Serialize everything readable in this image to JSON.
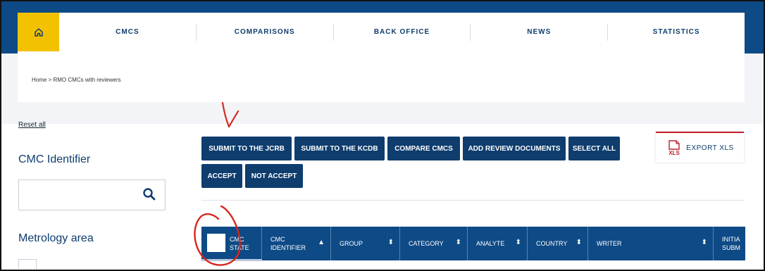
{
  "nav": {
    "items": [
      "CMCS",
      "COMPARISONS",
      "BACK OFFICE",
      "NEWS",
      "STATISTICS"
    ]
  },
  "breadcrumb": {
    "home": "Home",
    "separator": ">",
    "current": "RMO CMCs with reviewers"
  },
  "sidebar": {
    "reset": "Reset all",
    "cmc_identifier_heading": "CMC Identifier",
    "search_placeholder": "",
    "metrology_heading": "Metrology area"
  },
  "actions": {
    "submit_jcrb": "SUBMIT TO THE JCRB",
    "submit_kcdb": "SUBMIT TO THE KCDB",
    "compare": "COMPARE CMCS",
    "add_review": "ADD REVIEW DOCUMENTS",
    "select_all": "SELECT ALL",
    "accept": "ACCEPT",
    "not_accept": "NOT ACCEPT"
  },
  "export": {
    "icon_text": "XLS",
    "label": "EXPORT XLS"
  },
  "table": {
    "state": {
      "line1": "CMC",
      "line2": "STATE"
    },
    "identifier": {
      "line1": "CMC",
      "line2": "IDENTIFIER"
    },
    "group": "GROUP",
    "category": "CATEGORY",
    "analyte": "ANALYTE",
    "country": "COUNTRY",
    "writer": "WRITER",
    "initial": {
      "line1": "INITIA",
      "line2": "SUBM"
    }
  },
  "colors": {
    "brand_navy": "#0e3d6e",
    "header_blue": "#0e4a86",
    "home_yellow": "#f2c200",
    "export_red": "#c41e2a",
    "annotation_red": "#d9261c"
  },
  "icons": {
    "home": "home-icon",
    "search": "search-icon",
    "excel": "xls-file-icon",
    "sort": "sort-icon"
  }
}
